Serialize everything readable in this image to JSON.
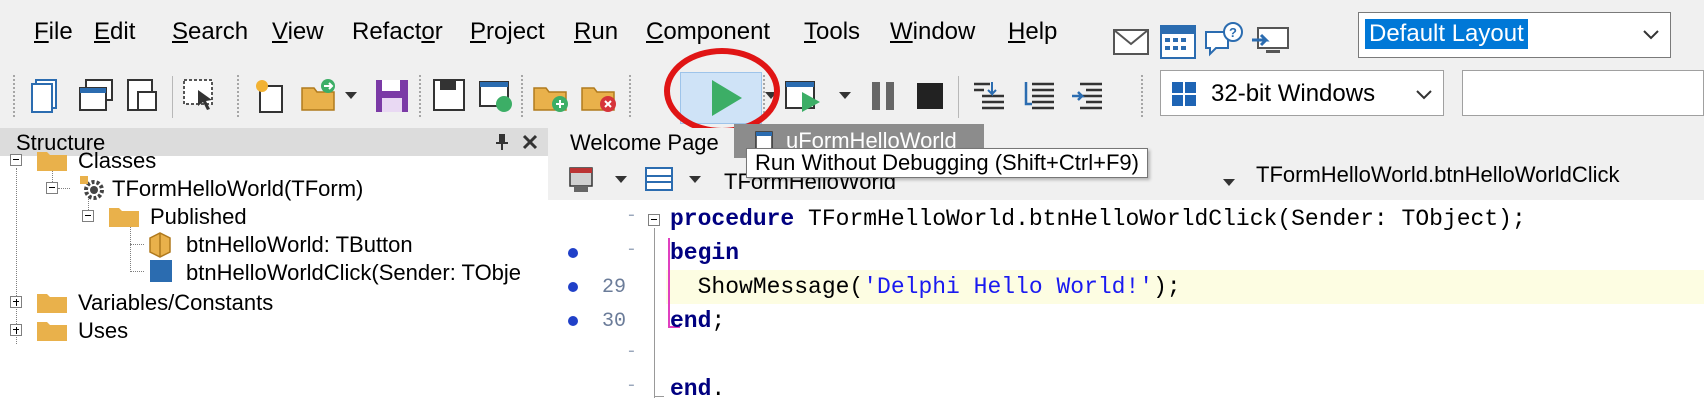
{
  "menu": {
    "items": [
      {
        "label": "File",
        "mnemonic": "F",
        "rest": "ile"
      },
      {
        "label": "Edit",
        "mnemonic": "E",
        "rest": "dit"
      },
      {
        "label": "Search",
        "mnemonic": "S",
        "rest": "earch"
      },
      {
        "label": "View",
        "mnemonic": "V",
        "rest": "iew"
      },
      {
        "label": "Refactor",
        "pre": "Refact",
        "mnemonic": "o",
        "rest": "r"
      },
      {
        "label": "Project",
        "mnemonic": "P",
        "rest": "roject"
      },
      {
        "label": "Run",
        "mnemonic": "R",
        "rest": "un"
      },
      {
        "label": "Component",
        "mnemonic": "C",
        "rest": "omponent"
      },
      {
        "label": "Tools",
        "mnemonic": "T",
        "rest": "ools"
      },
      {
        "label": "Window",
        "mnemonic": "W",
        "rest": "indow"
      },
      {
        "label": "Help",
        "mnemonic": "H",
        "rest": "elp"
      }
    ]
  },
  "layout_selector": {
    "value": "Default Layout"
  },
  "toolbar": {
    "platform": "32-bit Windows",
    "tooltip": "Run Without Debugging (Shift+Ctrl+F9)"
  },
  "structure": {
    "title": "Structure",
    "tree": {
      "classes": "Classes",
      "form_class": "TFormHelloWorld(TForm)",
      "published": "Published",
      "button_field": "btnHelloWorld: TButton",
      "click_method": "btnHelloWorldClick(Sender: TObje",
      "variables": "Variables/Constants",
      "uses": "Uses"
    }
  },
  "editor": {
    "tabs": {
      "welcome": "Welcome Page",
      "unit": "uFormHelloWorld"
    },
    "nav_class": "TFormHelloWorld",
    "nav_method": "TFormHelloWorld.btnHelloWorldClick",
    "code": {
      "l1_kw": "procedure",
      "l1_rest": " TFormHelloWorld.btnHelloWorldClick(Sender: TObject);",
      "l2_kw": "begin",
      "l3_pre": "  ShowMessage(",
      "l3_str": "'Delphi Hello World!'",
      "l3_post": ");",
      "l4_kw": "end",
      "l4_rest": ";",
      "l6_kw": "end",
      "l6_rest": "."
    },
    "line_numbers": {
      "n29": "29",
      "n30": "30"
    }
  },
  "colors": {
    "highlight": "#e01515",
    "selection": "#0078d7",
    "run_green": "#3cae66"
  }
}
